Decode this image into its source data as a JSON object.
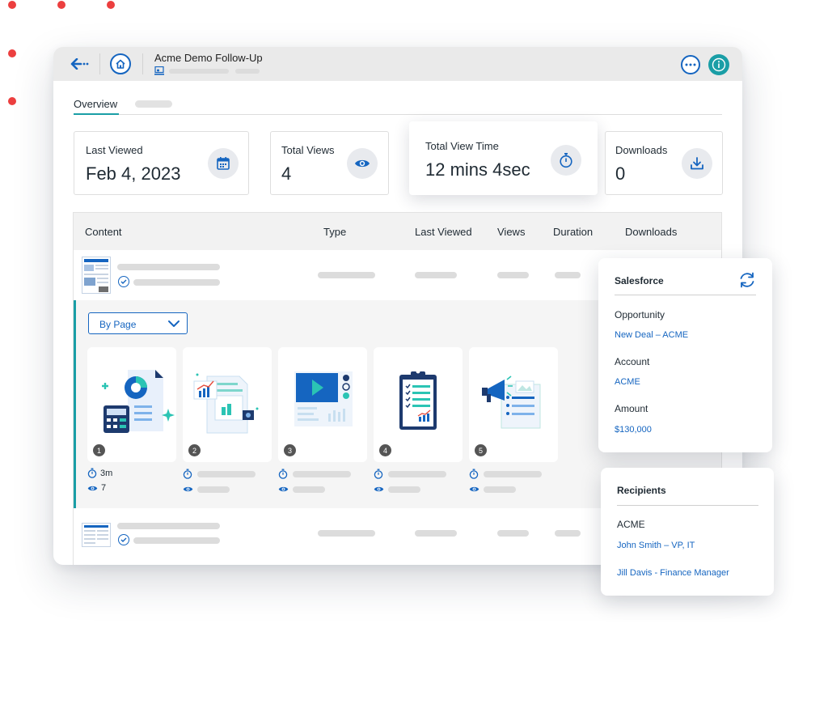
{
  "window": {
    "title": "Acme Demo Follow-Up"
  },
  "tabs": {
    "overview": "Overview"
  },
  "stats": {
    "last_viewed": {
      "label": "Last Viewed",
      "value": "Feb 4, 2023",
      "icon": "calendar-icon"
    },
    "total_views": {
      "label": "Total Views",
      "value": "4",
      "icon": "eye-icon"
    },
    "total_view_time": {
      "label": "Total View Time",
      "value": "12 mins 4sec",
      "icon": "stopwatch-icon"
    },
    "downloads": {
      "label": "Downloads",
      "value": "0",
      "icon": "download-icon"
    }
  },
  "table": {
    "columns": {
      "content": "Content",
      "type": "Type",
      "last_viewed": "Last Viewed",
      "views": "Views",
      "duration": "Duration",
      "downloads": "Downloads"
    }
  },
  "filter": {
    "selected": "By Page"
  },
  "pages": [
    {
      "number": "1",
      "duration": "3m",
      "views": "7"
    },
    {
      "number": "2"
    },
    {
      "number": "3"
    },
    {
      "number": "4"
    },
    {
      "number": "5"
    }
  ],
  "salesforce": {
    "title": "Salesforce",
    "opportunity_label": "Opportunity",
    "opportunity_value": "New Deal – ACME",
    "account_label": "Account",
    "account_value": "ACME",
    "amount_label": "Amount",
    "amount_value": "$130,000"
  },
  "recipients": {
    "title": "Recipients",
    "company": "ACME",
    "people": [
      "John Smith – VP, IT",
      "Jill Davis - Finance Manager"
    ]
  },
  "colors": {
    "accent_blue": "#1565c0",
    "teal": "#1a9ea6",
    "dot_red": "#ec3f3f"
  }
}
